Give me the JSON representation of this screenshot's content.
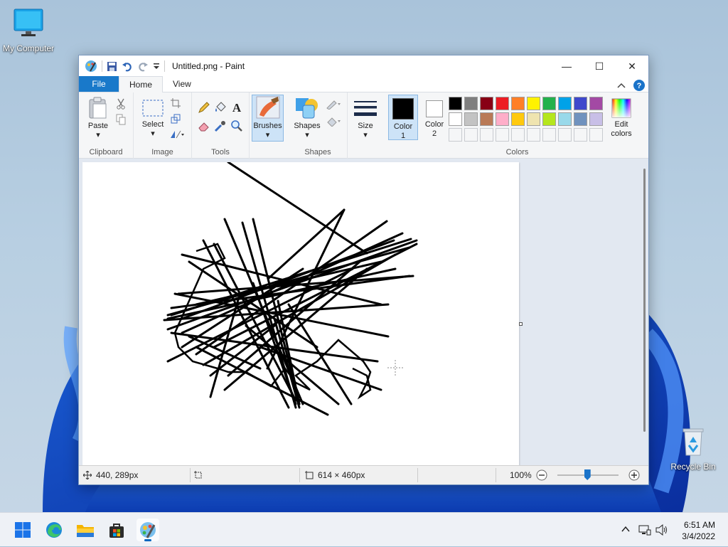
{
  "desktop": {
    "icons": [
      {
        "label": "My Computer"
      },
      {
        "label": "Recycle Bin"
      }
    ]
  },
  "window": {
    "title": "Untitled.png - Paint",
    "controls": {
      "minimize": "—",
      "maximize": "☐",
      "close": "✕"
    }
  },
  "tabs": [
    {
      "label": "File"
    },
    {
      "label": "Home"
    },
    {
      "label": "View"
    }
  ],
  "ribbon": {
    "groups": {
      "clipboard": "Clipboard",
      "image": "Image",
      "tools": "Tools",
      "shapes": "Shapes",
      "colors": "Colors"
    },
    "buttons": {
      "paste": "Paste",
      "select": "Select",
      "brushes": "Brushes",
      "shapes": "Shapes",
      "size": "Size",
      "color1": "Color",
      "color1_num": "1",
      "color2": "Color",
      "color2_num": "2",
      "edit_colors_1": "Edit",
      "edit_colors_2": "colors"
    },
    "color1_value": "#000000",
    "color2_value": "#ffffff",
    "palette_row1": [
      "#000000",
      "#7f7f7f",
      "#880015",
      "#ed1c24",
      "#ff7f27",
      "#fff200",
      "#22b14c",
      "#00a2e8",
      "#3f48cc",
      "#a349a4"
    ],
    "palette_row2": [
      "#ffffff",
      "#c3c3c3",
      "#b97a57",
      "#ffaec9",
      "#ffc90e",
      "#efe4b0",
      "#b5e61d",
      "#99d9ea",
      "#7092be",
      "#c8bfe7"
    ]
  },
  "status": {
    "cursor_pos": "440, 289px",
    "image_size": "614 × 460px",
    "zoom": "100%"
  },
  "taskbar": {
    "time": "6:51 AM",
    "date": "3/4/2022"
  }
}
